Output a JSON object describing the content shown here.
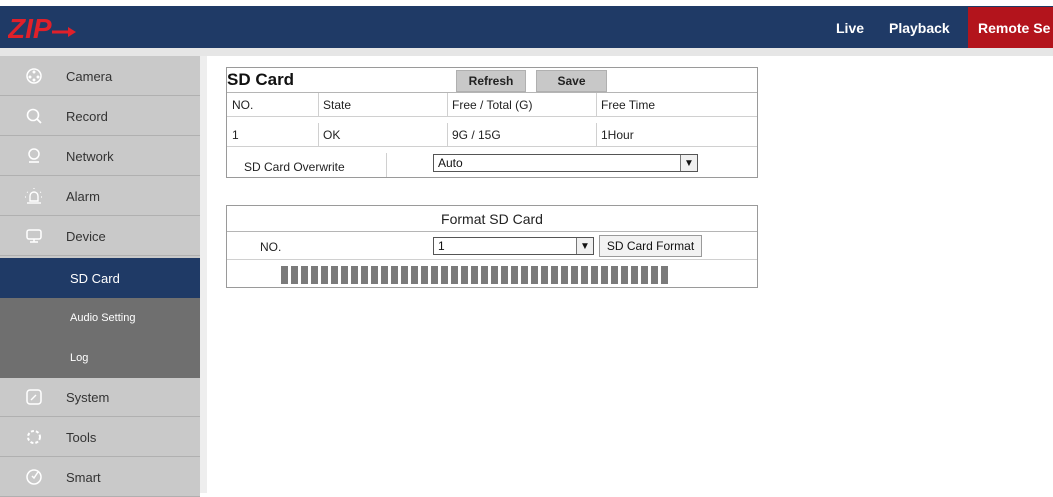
{
  "header": {
    "logo_text": "ZIP",
    "nav": [
      {
        "label": "Live"
      },
      {
        "label": "Playback"
      },
      {
        "label": "Remote Se"
      }
    ]
  },
  "sidebar": {
    "items": [
      {
        "label": "Camera",
        "icon": "camera-icon"
      },
      {
        "label": "Record",
        "icon": "search-icon"
      },
      {
        "label": "Network",
        "icon": "network-icon"
      },
      {
        "label": "Alarm",
        "icon": "alarm-icon"
      },
      {
        "label": "Device",
        "icon": "device-icon"
      },
      {
        "label": "System",
        "icon": "system-icon"
      },
      {
        "label": "Tools",
        "icon": "tools-icon"
      },
      {
        "label": "Smart",
        "icon": "smart-icon"
      }
    ],
    "subitems": [
      {
        "label": "SD Card",
        "active": true
      },
      {
        "label": "Audio Setting"
      },
      {
        "label": "Log"
      }
    ]
  },
  "sd_card": {
    "title": "SD Card",
    "refresh_label": "Refresh",
    "save_label": "Save",
    "columns": [
      "NO.",
      "State",
      "Free / Total (G)",
      "Free Time"
    ],
    "rows": [
      [
        "1",
        "OK",
        "9G / 15G",
        "1Hour"
      ]
    ],
    "overwrite_label": "SD Card Overwrite",
    "overwrite_value": "Auto"
  },
  "format": {
    "title": "Format SD Card",
    "no_label": "NO.",
    "no_value": "1",
    "format_button": "SD Card Format",
    "progress_segments": 39
  },
  "colors": {
    "header_bg": "#1f3a66",
    "remote_bg": "#b3141c",
    "active_sub_bg": "#1f3a66",
    "sub_bg": "#6f6f6f",
    "sidebar_bg": "#c9c9c9"
  }
}
